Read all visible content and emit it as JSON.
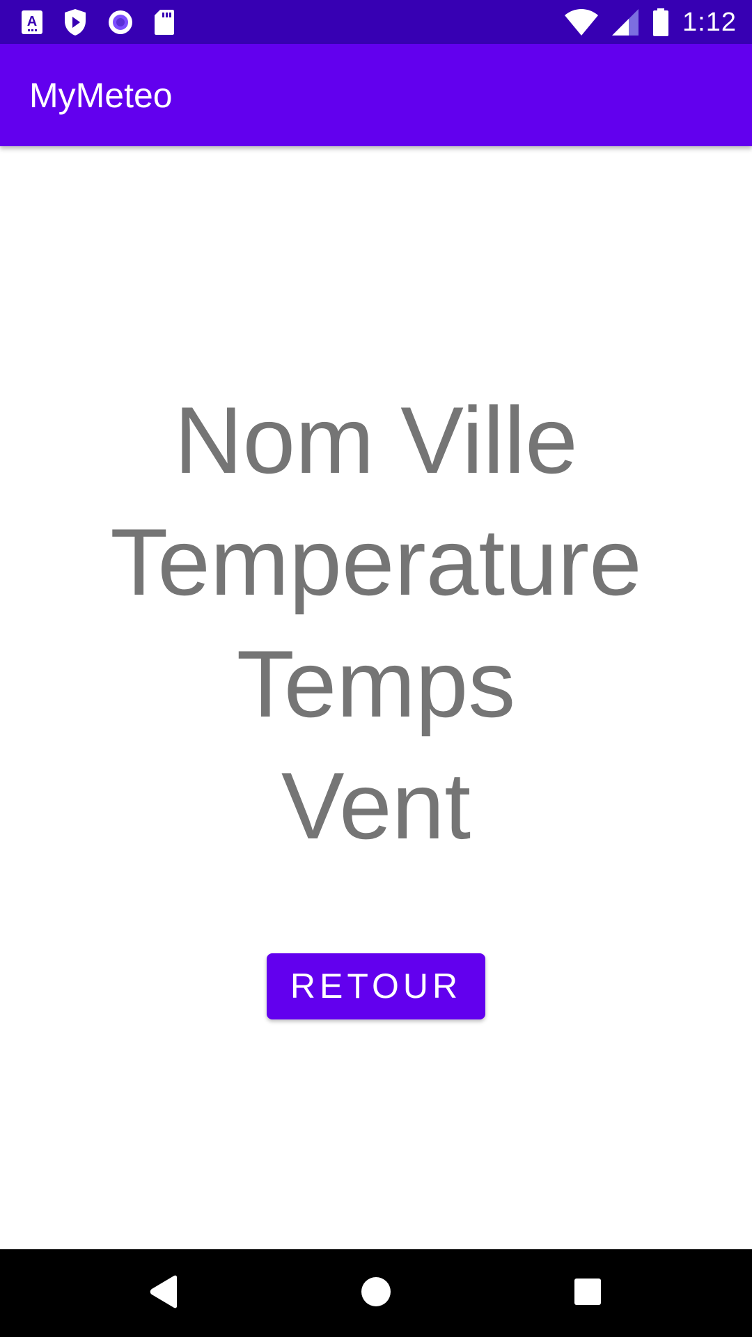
{
  "status_bar": {
    "time": "1:12",
    "left_icons": [
      "accessibility-app-icon",
      "play-shield-icon",
      "record-circle-icon",
      "sd-card-icon"
    ],
    "right_icons": [
      "wifi-icon",
      "cell-signal-icon",
      "battery-icon"
    ]
  },
  "app_bar": {
    "title": "MyMeteo"
  },
  "weather": {
    "city": "Nom Ville",
    "temperature": "Temperature",
    "conditions": "Temps",
    "wind": "Vent"
  },
  "actions": {
    "back_label": "RETOUR"
  },
  "nav_bar": {
    "icons": [
      "back-icon",
      "home-icon",
      "recents-icon"
    ]
  },
  "colors": {
    "status_bar": "#3700b3",
    "primary": "#6200ee",
    "text_secondary": "#757575",
    "nav_bar": "#000000"
  }
}
